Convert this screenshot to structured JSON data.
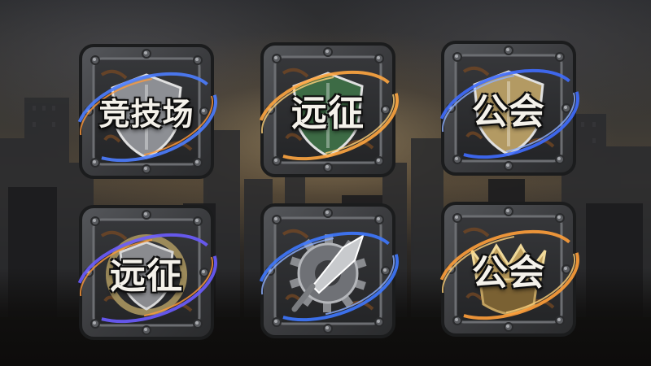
{
  "background": {
    "scene": "ruined-city-skyline",
    "sky_color": "#3d3a35",
    "glow_color": "#bfa06e"
  },
  "tiles": [
    {
      "name": "arena",
      "label": "竞技场",
      "emblem": "shield-icon",
      "shield_color": "#8d8f94",
      "aura_color": "#4d7dff",
      "aura_color_2": "#ff9a3c"
    },
    {
      "name": "expedition",
      "label": "远征",
      "emblem": "shield-icon",
      "shield_color": "#3d6b45",
      "aura_color": "#ffa640",
      "aura_color_2": "#ffd27a"
    },
    {
      "name": "guild",
      "label": "公会",
      "emblem": "shield-icon",
      "shield_color": "#b39a63",
      "aura_color": "#3f6dff",
      "aura_color_2": "#8fb0ff"
    },
    {
      "name": "expedition-2",
      "label": "远征",
      "emblem": "round-shield-icon",
      "shield_color": "#8a8b8f",
      "aura_color": "#6c5cff",
      "aura_color_2": "#ff9a3c"
    },
    {
      "name": "battle",
      "label": "",
      "emblem": "gear-spear-icon",
      "shield_color": "#9a9ca1",
      "aura_color": "#3e78ff",
      "aura_color_2": "#8fb0ff"
    },
    {
      "name": "guild-2",
      "label": "公会",
      "emblem": "crown-icon",
      "shield_color": "#c2a260",
      "aura_color": "#ff9f3a",
      "aura_color_2": "#ffd27a"
    }
  ]
}
